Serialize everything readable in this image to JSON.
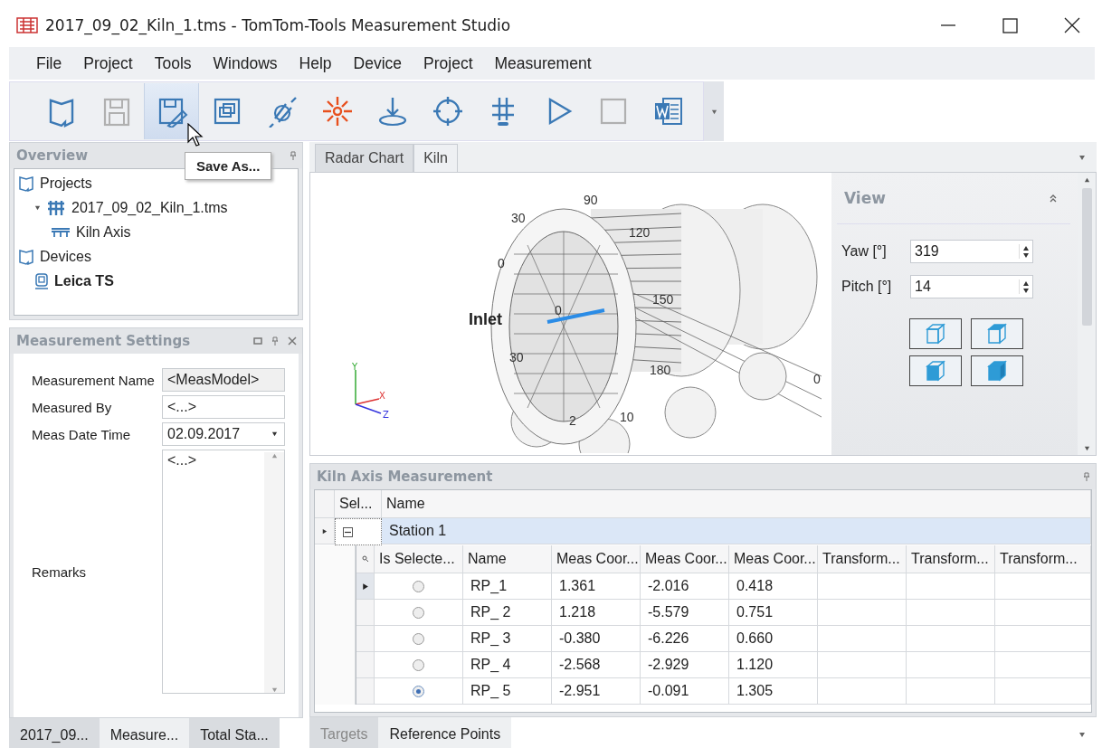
{
  "window": {
    "title": "2017_09_02_Kiln_1.tms - TomTom-Tools Measurement Studio"
  },
  "menu": [
    "File",
    "Project",
    "Tools",
    "Windows",
    "Help",
    "Device",
    "Project",
    "Measurement"
  ],
  "toolbar": {
    "buttons": [
      {
        "kind": "project",
        "disabled": false,
        "pressed": false
      },
      {
        "kind": "save",
        "disabled": true,
        "pressed": false
      },
      {
        "kind": "save-as",
        "disabled": false,
        "pressed": true
      },
      {
        "kind": "windows",
        "disabled": false,
        "pressed": false
      },
      {
        "kind": "connect",
        "disabled": false,
        "pressed": false
      },
      {
        "kind": "laser",
        "disabled": false,
        "pressed": false
      },
      {
        "kind": "station",
        "disabled": false,
        "pressed": false
      },
      {
        "kind": "target",
        "disabled": false,
        "pressed": false
      },
      {
        "kind": "level",
        "disabled": false,
        "pressed": false
      },
      {
        "kind": "play",
        "disabled": false,
        "pressed": false
      },
      {
        "kind": "stop",
        "disabled": true,
        "pressed": false
      },
      {
        "kind": "word",
        "disabled": false,
        "pressed": false
      }
    ],
    "tooltip": "Save As..."
  },
  "overview": {
    "title": "Overview",
    "tree": [
      {
        "label": "Projects",
        "kind": "folder",
        "active": false,
        "children": [
          {
            "label": "2017_09_02_Kiln_1.tms",
            "kind": "kiln",
            "active": false,
            "expanded": true,
            "children": [
              {
                "label": "Kiln Axis",
                "kind": "axis",
                "active": false
              }
            ]
          }
        ]
      },
      {
        "label": "Devices",
        "kind": "folder",
        "active": false,
        "children": [
          {
            "label": "Leica TS",
            "kind": "device",
            "active": true
          }
        ]
      }
    ]
  },
  "settings": {
    "title": "Measurement Settings",
    "fields": [
      {
        "label": "Measurement Name",
        "value": "<MeasModel>",
        "kind": "readonly"
      },
      {
        "label": "Measured By",
        "value": "<...>",
        "kind": "text"
      },
      {
        "label": "Meas Date Time",
        "value": "02.09.2017",
        "kind": "date"
      },
      {
        "label": "Remarks",
        "value": "<...>",
        "kind": "memo"
      }
    ]
  },
  "left_tabs": [
    {
      "label": "2017_09...",
      "selected": false
    },
    {
      "label": "Measure...",
      "selected": true
    },
    {
      "label": "Total Sta...",
      "selected": false
    }
  ],
  "doc_tabs": [
    {
      "label": "Radar Chart",
      "selected": false
    },
    {
      "label": "Kiln",
      "selected": true
    }
  ],
  "kiln_view": {
    "inlet_label": "Inlet",
    "scale_labels": [
      "90",
      "30",
      "0",
      "120",
      "0",
      "150",
      "30",
      "180",
      "0",
      "10",
      "2"
    ],
    "axes": [
      "Y",
      "X",
      "Z"
    ]
  },
  "view_panel": {
    "title": "View",
    "fields": [
      {
        "label": "Yaw [°]",
        "value": "319"
      },
      {
        "label": "Pitch [°]",
        "value": "14"
      }
    ],
    "cube_buttons": [
      {
        "kind": "front"
      },
      {
        "kind": "top"
      },
      {
        "kind": "side"
      },
      {
        "kind": "solid"
      }
    ]
  },
  "measurement": {
    "title": "Kiln Axis Measurement",
    "columns": [
      "Sel...",
      "Name"
    ],
    "group": {
      "name": "Station 1",
      "expanded": true,
      "selected": true
    },
    "columns_inner": [
      "Is Selecte...",
      "Name",
      "Meas Coor...",
      "Meas Coor...",
      "Meas Coor...",
      "Transform...",
      "Transform...",
      "Transform..."
    ],
    "rows": [
      {
        "selected": false,
        "current": true,
        "cells": [
          "RP_1",
          "1.361",
          "-2.016",
          "0.418"
        ]
      },
      {
        "selected": false,
        "current": false,
        "cells": [
          "RP_ 2",
          "1.218",
          "-5.579",
          "0.751"
        ]
      },
      {
        "selected": false,
        "current": false,
        "cells": [
          "RP_ 3",
          "-0.380",
          "-6.226",
          "0.660"
        ]
      },
      {
        "selected": false,
        "current": false,
        "cells": [
          "RP_ 4",
          "-2.568",
          "-2.929",
          "1.120"
        ]
      },
      {
        "selected": true,
        "current": false,
        "cells": [
          "RP_ 5",
          "-2.951",
          "-0.091",
          "1.305"
        ]
      }
    ]
  },
  "bottom_tabs": [
    {
      "label": "Targets",
      "selected": false
    },
    {
      "label": "Reference Points",
      "selected": true
    }
  ]
}
